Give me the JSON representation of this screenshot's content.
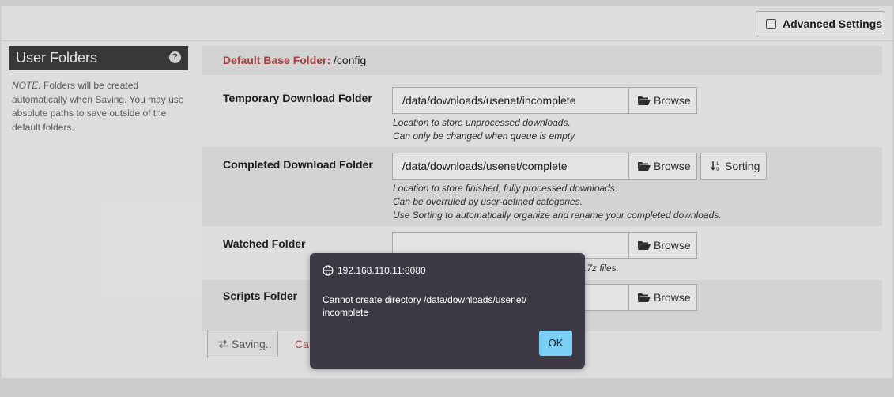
{
  "header": {
    "advanced_settings_label": "Advanced Settings"
  },
  "sidebar": {
    "title": "User Folders",
    "help_icon": "?",
    "note_prefix": "NOTE:",
    "note_text": " Folders will be created automatically when Saving. You may use absolute paths to save outside of the default folders."
  },
  "base_folder": {
    "label": "Default Base Folder:",
    "value": " /config"
  },
  "folders": [
    {
      "label": "Temporary Download Folder",
      "value": "/data/downloads/usenet/incomplete",
      "browse_label": "Browse",
      "help": [
        "Location to store unprocessed downloads.",
        "Can only be changed when queue is empty."
      ]
    },
    {
      "label": "Completed Download Folder",
      "value": "/data/downloads/usenet/complete",
      "browse_label": "Browse",
      "sorting_label": "Sorting",
      "help": [
        "Location to store finished, fully processed downloads.",
        "Can be overruled by user-defined categories.",
        "Use Sorting to automatically organize and rename your completed downloads."
      ]
    },
    {
      "label": "Watched Folder",
      "value": "",
      "browse_label": "Browse",
      "help_partial": ".7z files."
    },
    {
      "label": "Scripts Folder",
      "value": "",
      "browse_label": "Browse"
    }
  ],
  "footer": {
    "saving_label": "Saving..",
    "cancel_partial": "Ca"
  },
  "dialog": {
    "origin": "192.168.110.11:8080",
    "message_line1": "Cannot create directory /data/downloads/usenet/",
    "message_line2": "incomplete",
    "ok_label": "OK"
  },
  "colors": {
    "accent_red": "#b14b48",
    "dialog_bg": "#3d3a46",
    "ok_button": "#7cd0f5",
    "sidebar_title_bg": "#3f3f3f"
  },
  "icons": [
    "checkbox-icon",
    "help-icon",
    "folder-open-icon",
    "sort-icon",
    "globe-icon"
  ]
}
